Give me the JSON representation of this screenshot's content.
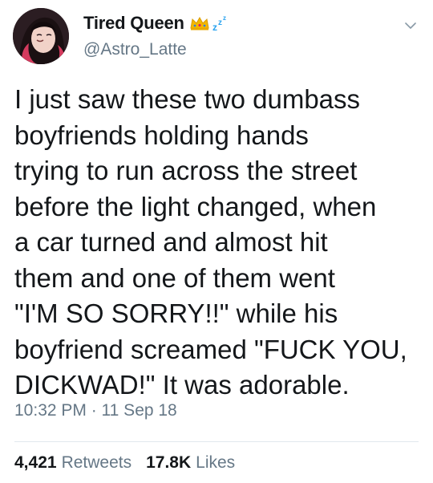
{
  "author": {
    "display_name": "Tired Queen",
    "handle": "@Astro_Latte",
    "badges": [
      "crown-icon",
      "sleeping-zzz-icon"
    ]
  },
  "tweet": {
    "text": "I just saw these two dumbass\nboyfriends holding hands\ntrying to run across the street\nbefore the light changed, when\na car turned and almost hit\nthem and one of them went\n\"I'M SO SORRY!!\" while his\nboyfriend screamed \"FUCK YOU,\nDICKWAD!\" It was adorable.",
    "timestamp": "10:32 PM · 11 Sep 18"
  },
  "stats": {
    "retweets_count": "4,421",
    "retweets_label": "Retweets",
    "likes_count": "17.8K",
    "likes_label": "Likes"
  },
  "colors": {
    "primary_text": "#14171a",
    "secondary_text": "#657786",
    "divider": "#e1e8ed",
    "crown": "#f5b800",
    "zzz": "#2aa3ef"
  }
}
